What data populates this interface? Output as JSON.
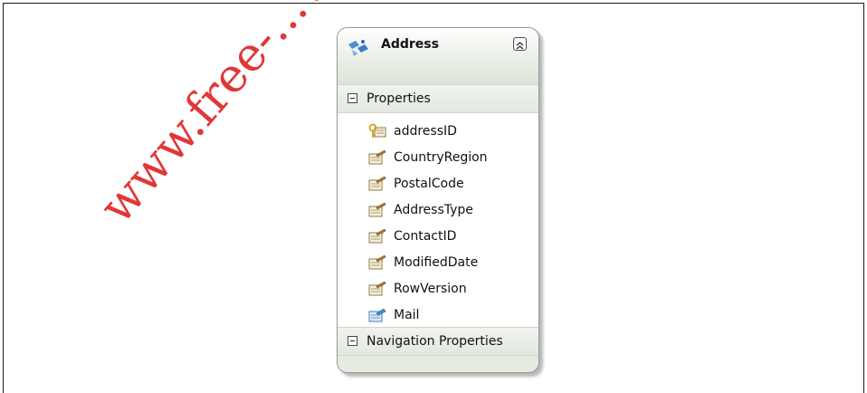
{
  "entity": {
    "title": "Address",
    "sections": [
      {
        "label": "Properties"
      },
      {
        "label": "Navigation Properties"
      }
    ],
    "properties": [
      {
        "name": "addressID",
        "icon": "key-property-icon"
      },
      {
        "name": "CountryRegion",
        "icon": "property-icon"
      },
      {
        "name": "PostalCode",
        "icon": "property-icon"
      },
      {
        "name": "AddressType",
        "icon": "property-icon"
      },
      {
        "name": "ContactID",
        "icon": "property-icon"
      },
      {
        "name": "ModifiedDate",
        "icon": "property-icon"
      },
      {
        "name": "RowVersion",
        "icon": "property-icon"
      },
      {
        "name": "Mail",
        "icon": "complex-property-icon"
      }
    ]
  },
  "watermark": "www.free-...vn"
}
